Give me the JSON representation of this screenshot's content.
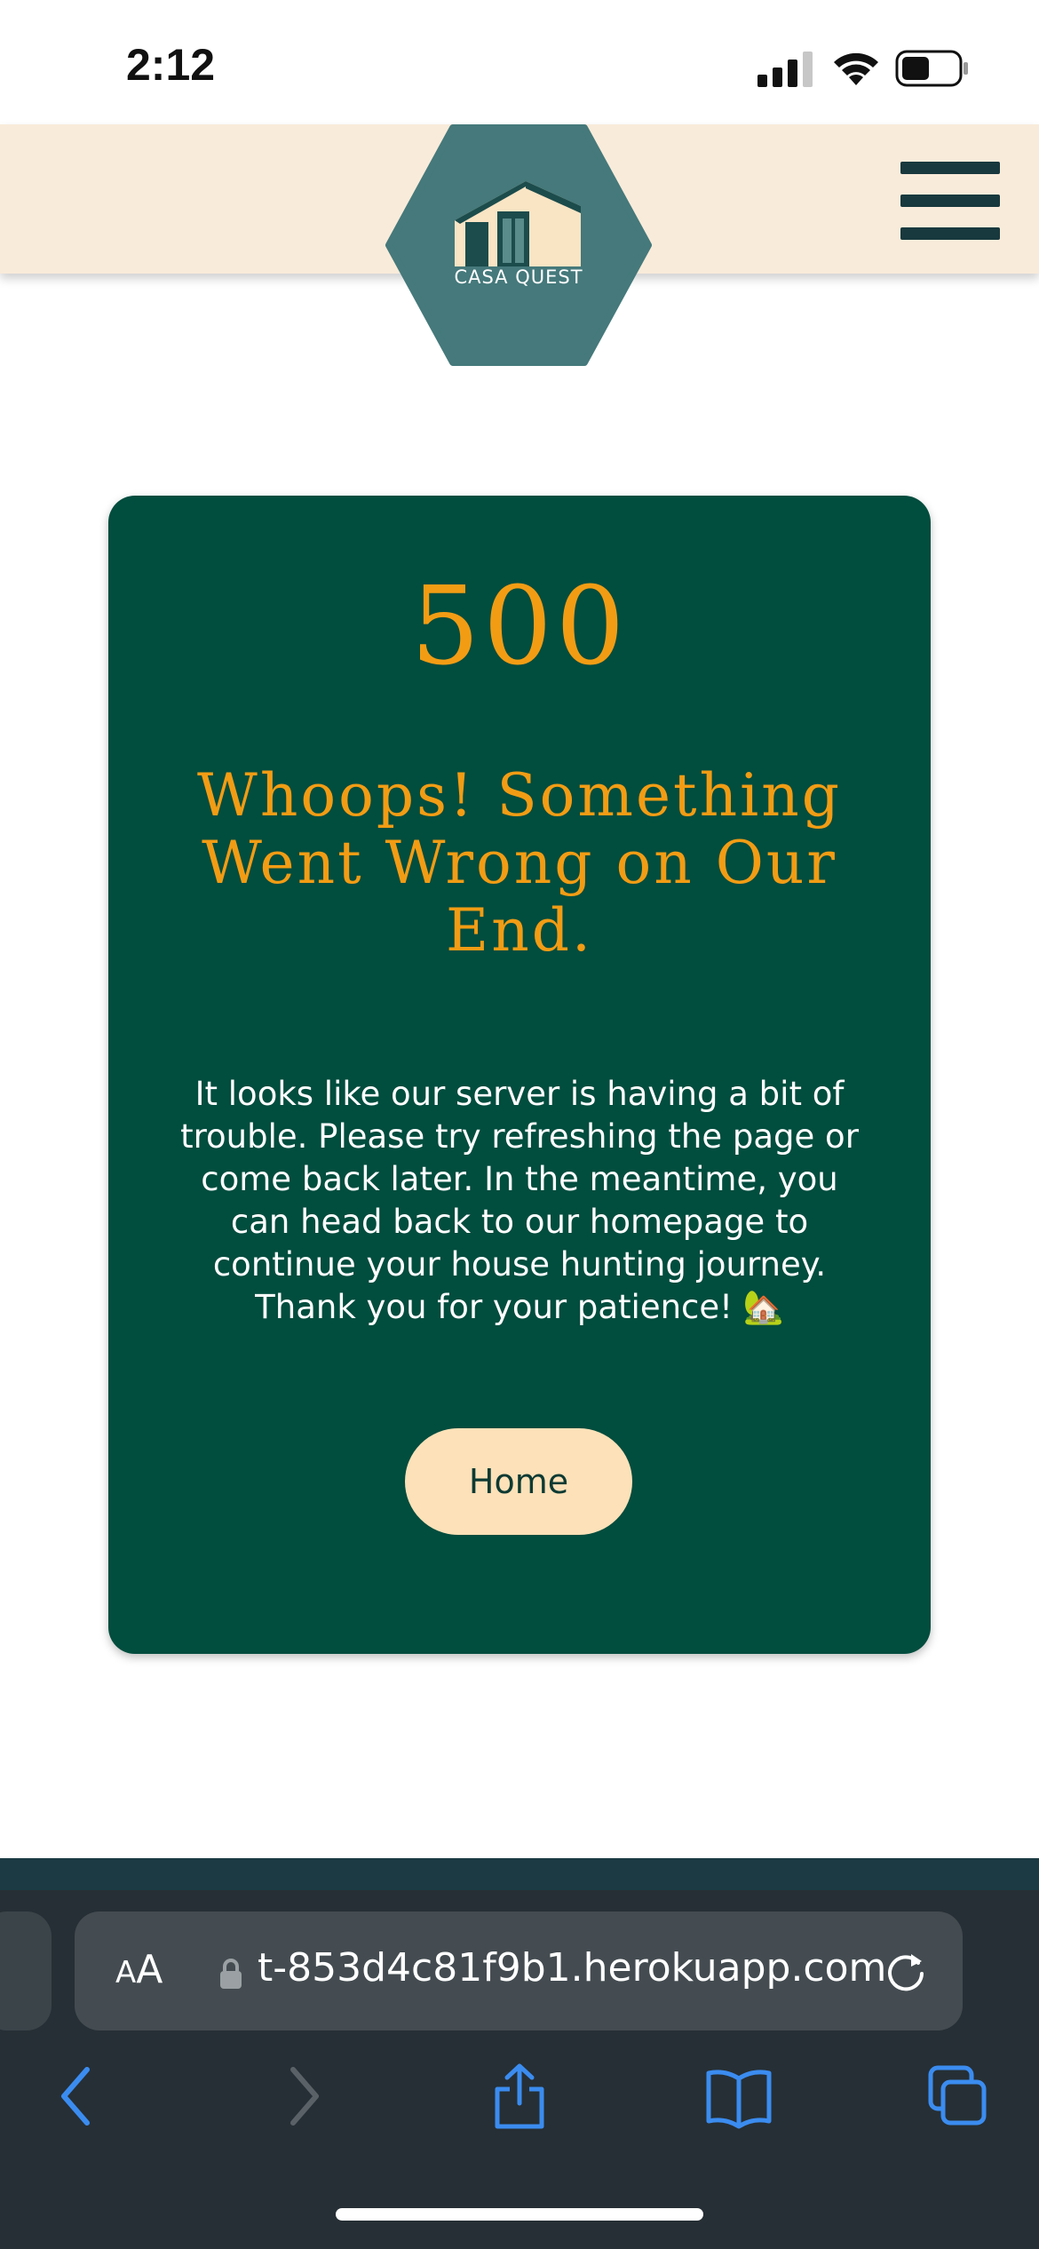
{
  "status_bar": {
    "time": "2:12"
  },
  "header": {
    "logo_text": "CASA QUEST"
  },
  "error": {
    "code": "500",
    "title": "Whoops! Something Went Wrong on Our End.",
    "message": "It looks like our server is having a bit of trouble. Please try refreshing the page or come back later. In the meantime, you can head back to our homepage to continue your house hunting journey. Thank you for your patience! 🏡",
    "home_label": "Home"
  },
  "browser": {
    "aa_label_small": "A",
    "aa_label_big": "A",
    "url": "t-853d4c81f9b1.herokuapp.com"
  },
  "colors": {
    "card_bg": "#014d3e",
    "accent": "#f29c14",
    "header_bg": "#f9ebda",
    "button_bg": "#fde1b8",
    "logo_bg": "#45797b"
  }
}
